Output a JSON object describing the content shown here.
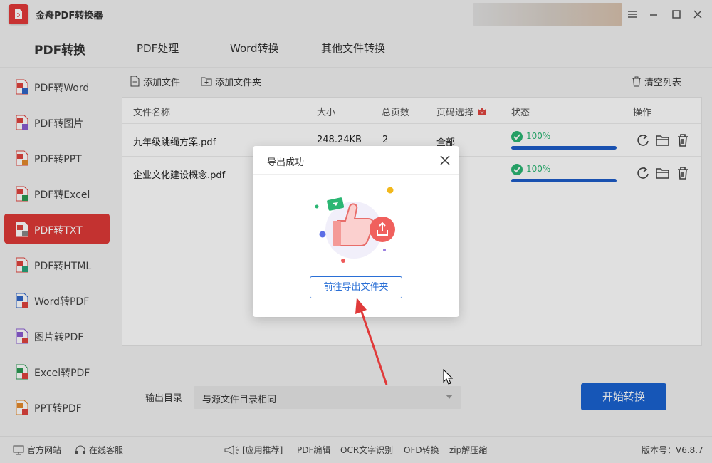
{
  "app": {
    "title": "金舟PDF转换器"
  },
  "main_tabs": [
    {
      "label": "PDF转换"
    },
    {
      "label": "PDF处理"
    },
    {
      "label": "Word转换"
    },
    {
      "label": "其他文件转换"
    }
  ],
  "sidebar": {
    "items": [
      {
        "label": "PDF转Word"
      },
      {
        "label": "PDF转图片"
      },
      {
        "label": "PDF转PPT"
      },
      {
        "label": "PDF转Excel"
      },
      {
        "label": "PDF转TXT"
      },
      {
        "label": "PDF转HTML"
      },
      {
        "label": "Word转PDF"
      },
      {
        "label": "图片转PDF"
      },
      {
        "label": "Excel转PDF"
      },
      {
        "label": "PPT转PDF"
      }
    ],
    "active_index": 4
  },
  "toolbar": {
    "add_file": "添加文件",
    "add_folder": "添加文件夹",
    "clear_list": "清空列表"
  },
  "table": {
    "headers": {
      "name": "文件名称",
      "size": "大小",
      "pages": "总页数",
      "page_select": "页码选择",
      "status": "状态",
      "ops": "操作"
    },
    "rows": [
      {
        "name": "九年级跳绳方案.pdf",
        "size": "248.24KB",
        "pages": "2",
        "page_select": "全部",
        "status": "100%",
        "progress": 1.0
      },
      {
        "name": "企业文化建设概念.pdf",
        "size": "",
        "pages": "",
        "page_select": "",
        "status": "100%",
        "progress": 1.0
      }
    ]
  },
  "output": {
    "label": "输出目录",
    "value": "与源文件目录相同"
  },
  "start_button": "开始转换",
  "footer": {
    "website": "官方网站",
    "service": "在线客服",
    "recommend": "[应用推荐]",
    "links": [
      "PDF编辑",
      "OCR文字识别",
      "OFD转换",
      "zip解压缩"
    ],
    "version": "版本号：V6.8.7"
  },
  "dialog": {
    "title": "导出成功",
    "button": "前往导出文件夹"
  },
  "colors": {
    "accent_red": "#df3a37",
    "primary_blue": "#1a62d1",
    "success_green": "#2bb673"
  }
}
